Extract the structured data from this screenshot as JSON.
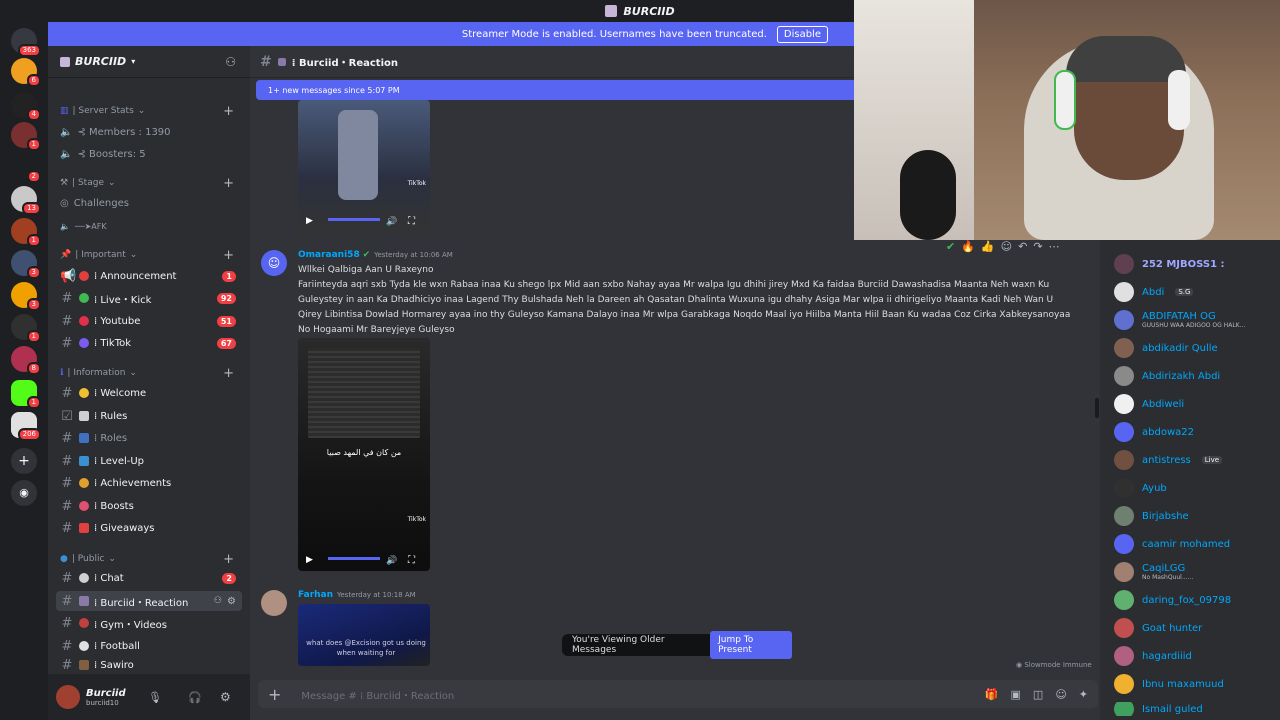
{
  "titlebar": {
    "title": "BURCIID"
  },
  "streamer": {
    "text": "Streamer Mode is enabled. Usernames have been truncated.",
    "disable": "Disable"
  },
  "guilds": {
    "badges": [
      "363",
      "6",
      "4",
      "1",
      "2",
      "13",
      "1",
      "3",
      "3",
      "1",
      "8",
      "1",
      "206"
    ]
  },
  "server": {
    "name": "BURCIID"
  },
  "categories": {
    "server_stats": "| Server Stats",
    "stage": "| Stage",
    "important": "| Important",
    "information": "| Information",
    "public": "| Public"
  },
  "channels": {
    "members": "⊰ Members : 1390",
    "boosters": "⊰ Boosters: 5",
    "challenges": "Challenges",
    "afk": "──➤AFK",
    "announcement": "⁞ Announcement",
    "announcement_count": "1",
    "live_kick": "⁞ Live・Kick",
    "live_kick_count": "92",
    "youtube": "⁞ Youtube",
    "youtube_count": "51",
    "tiktok": "⁞ TikTok",
    "tiktok_count": "67",
    "welcome": "⁞ Welcome",
    "rules": "⁞ Rules",
    "roles": "⁞ Roles",
    "levelup": "⁞ Level-Up",
    "achievements": "⁞ Achievements",
    "boosts": "⁞ Boosts",
    "giveaways": "⁞ Giveaways",
    "chat": "⁞ Chat",
    "chat_count": "2",
    "reaction": "⁞ Burciid・Reaction",
    "gym": "⁞ Gym・Videos",
    "football": "⁞ Football",
    "sawiro": "⁞ Sawiro"
  },
  "user": {
    "name": "Burciid",
    "tag": "burciid10"
  },
  "header": {
    "channel": "⁞ Burciid・Reaction"
  },
  "newmsg": {
    "text": "1+ new messages since 5:07 PM"
  },
  "messages": [
    {
      "author": "Omaraani58",
      "time": "Yesterday at 10:06 AM",
      "line1": "Wllkei Qalbiga Aan U Raxeyno",
      "body": "Fariinteyda aqri sxb Tyda kle wxn Rabaa inaa Ku shego lpx Mid aan sxbo Nahay ayaa Mr walpa Igu dhihi jirey Mxd Ka faidaa Burciid Dawashadisa Maanta Neh waxn Ku Guleystey in aan Ka Dhadhiciyo inaa Lagend Thy Bulshada Neh la Dareen ah Qasatan Dhalinta Wuxuna igu dhahy Asiga Mar wlpa ii dhirigeliyo Maanta Kadi Neh Wan U Qirey Libintisa Dowlad Hormarey ayaa ino thy Guleyso Kamana Dalayo inaa Mr wlpa Garabkaga Noqdo Maal iyo Hiilba Manta Hiil Baan Ku wadaa Coz Cirka Xabkeysanoyaa No Hogaami Mr Bareyjeye Guleyso",
      "video_caption": "من كان في المهد صبيا"
    },
    {
      "author": "Farhan",
      "time": "Yesterday at 10:18 AM",
      "video_caption": "what does @Excision got us doing when waiting for"
    }
  ],
  "tiktok_label": "TikTok",
  "older": {
    "text": "You're Viewing Older Messages",
    "jump": "Jump To Present"
  },
  "slowmode": "Slowmode Immune",
  "composer": {
    "placeholder": "Message # ⁞ Burciid・Reaction"
  },
  "members": [
    {
      "name": "252 MJBOSS1 :"
    },
    {
      "name": "Abdi",
      "tag": "S.G"
    },
    {
      "name": "ABDIFATAH OG",
      "sub": "GUUSHU WAA ADIGOO OG HALK..."
    },
    {
      "name": "abdikadir Qulle"
    },
    {
      "name": "Abdirizakh Abdi"
    },
    {
      "name": "Abdiweli"
    },
    {
      "name": "abdowa22"
    },
    {
      "name": "antistress",
      "tag": "Live"
    },
    {
      "name": "Ayub"
    },
    {
      "name": "Birjabshe"
    },
    {
      "name": "caamir mohamed"
    },
    {
      "name": "CaqiLGG",
      "sub": "No MashQuul......"
    },
    {
      "name": "daring_fox_09798"
    },
    {
      "name": "Goat hunter"
    },
    {
      "name": "hagardiiid"
    },
    {
      "name": "Ibnu maxamuud"
    },
    {
      "name": "Ismail guled"
    }
  ],
  "colors": {
    "accent": "#5865f2",
    "bg": "#313338",
    "sidebar": "#2b2d31",
    "rail": "#1e1f22",
    "mention": "#f23f43"
  }
}
